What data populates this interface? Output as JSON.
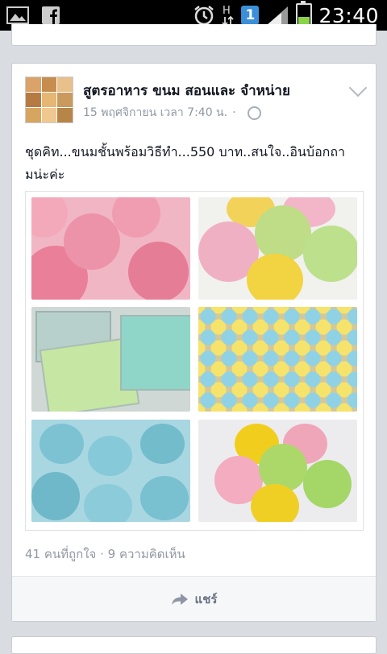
{
  "status_bar": {
    "time": "23:40",
    "sim_number": "1",
    "icons": [
      "gallery-icon",
      "facebook-icon",
      "alarm-icon",
      "data-arrows-icon",
      "signal-icon",
      "battery-charging-icon"
    ]
  },
  "post": {
    "page_name": "สูตรอาหาร ขนม สอนและ จำหน่าย",
    "timestamp": "15 พฤศจิกายน เวลา 7:40 น.",
    "separator": "·",
    "privacy_icon": "globe-icon",
    "text": "ชุดคิท...ขนมชั้นพร้อมวิธีทำ...550 บาท..สนใจ..อินบ้อกถามน่ะค่ะ",
    "photos": [
      {
        "name": "pink-rose-jelly",
        "colors": [
          "#e98ca2",
          "#f2b3c3"
        ]
      },
      {
        "name": "pastel-rose-jelly",
        "colors": [
          "#c8e28a",
          "#f3d36a",
          "#f0b3c8"
        ]
      },
      {
        "name": "trays-of-jelly",
        "colors": [
          "#c9dde0",
          "#a8e38a",
          "#7ad1c4"
        ]
      },
      {
        "name": "colorful-cups",
        "colors": [
          "#f6e06a",
          "#8ad3e8",
          "#f5a6c9"
        ]
      },
      {
        "name": "blue-rose-jelly",
        "colors": [
          "#7fc3d3",
          "#b9e0ea"
        ]
      },
      {
        "name": "four-rose-jelly",
        "colors": [
          "#f0d12a",
          "#f2a7bb",
          "#a9d86a"
        ]
      }
    ],
    "likes": "41 คนที่ถูกใจ",
    "dot": "·",
    "comments": "9 ความคิดเห็น",
    "share_label": "แชร์"
  },
  "colors": {
    "background": "#d9dce1",
    "card": "#ffffff",
    "muted_text": "#9197a3"
  }
}
